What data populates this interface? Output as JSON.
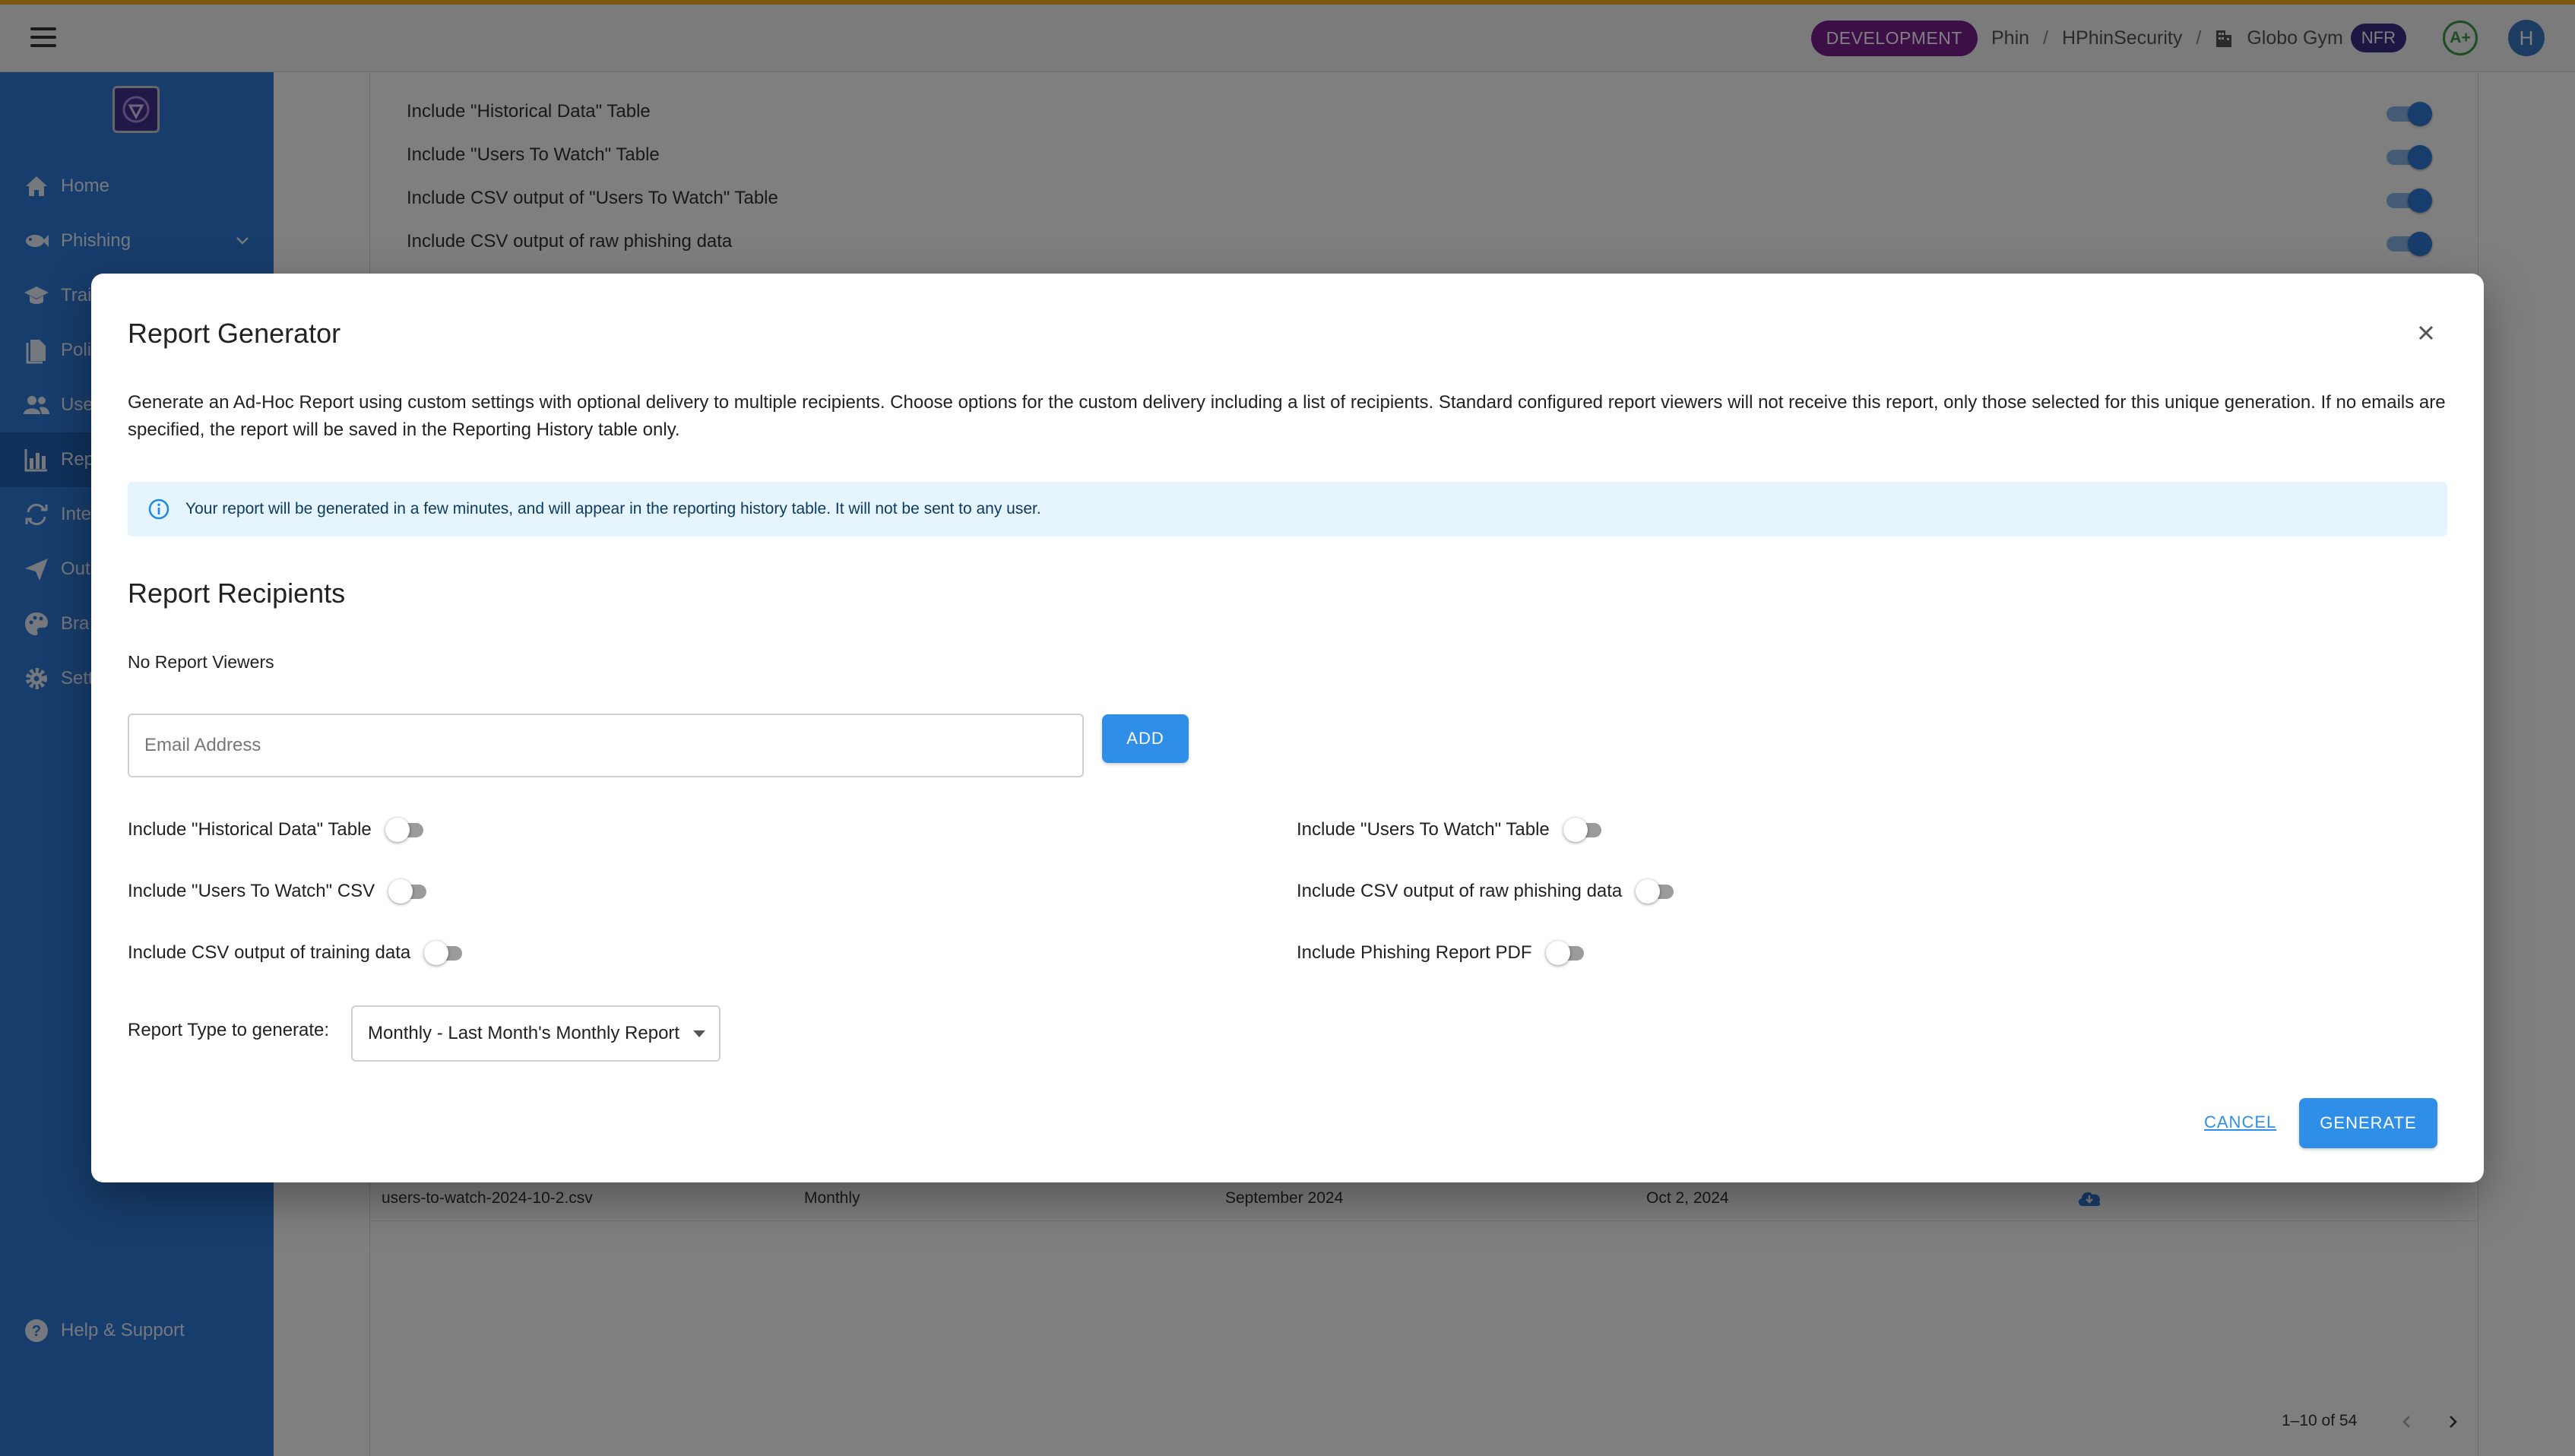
{
  "topbar": {
    "env_badge": "DEVELOPMENT",
    "breadcrumbs": [
      "Phin",
      "HPhinSecurity",
      "Globo Gym"
    ],
    "separator": "/",
    "nfr_badge": "NFR",
    "grade": "A+",
    "avatar_initial": "H",
    "accent_color": "#f5b21b"
  },
  "sidebar": {
    "items": [
      {
        "label": "Home",
        "icon": "home-icon"
      },
      {
        "label": "Phishing",
        "icon": "fish-icon"
      },
      {
        "label": "Trai",
        "icon": "graduation-cap-icon"
      },
      {
        "label": "Poli",
        "icon": "document-icon"
      },
      {
        "label": "Use",
        "icon": "users-icon"
      },
      {
        "label": "Rep",
        "icon": "bar-chart-icon"
      },
      {
        "label": "Inte",
        "icon": "sync-icon"
      },
      {
        "label": "Out",
        "icon": "send-icon"
      },
      {
        "label": "Bra",
        "icon": "palette-icon"
      },
      {
        "label": "Sett",
        "icon": "gear-icon"
      }
    ],
    "help_label": "Help & Support",
    "color": "#2f7ad9"
  },
  "background": {
    "options": [
      "Include \"Historical Data\" Table",
      "Include \"Users To Watch\" Table",
      "Include CSV output of \"Users To Watch\" Table",
      "Include CSV output of raw phishing data"
    ],
    "table_row": {
      "file": "users-to-watch-2024-10-2.csv",
      "frequency": "Monthly",
      "period": "September 2024",
      "date": "Oct 2, 2024"
    },
    "pagination": "1–10 of 54"
  },
  "dialog": {
    "title": "Report Generator",
    "description": "Generate an Ad-Hoc Report using custom settings with optional delivery to multiple recipients. Choose options for the custom delivery including a list of recipients. Standard configured report viewers will not receive this report, only those selected for this unique generation. If no emails are specified, the report will be saved in the Reporting History table only.",
    "alert": "Your report will be generated in a few minutes, and will appear in the reporting history table. It will not be sent to any user.",
    "recipients_title": "Report Recipients",
    "no_viewers": "No Report Viewers",
    "email_placeholder": "Email Address",
    "add_label": "ADD",
    "options_left": [
      {
        "label": "Include \"Historical Data\" Table",
        "checked": false
      },
      {
        "label": "Include \"Users To Watch\" CSV",
        "checked": false
      },
      {
        "label": "Include CSV output of training data",
        "checked": false
      }
    ],
    "options_right": [
      {
        "label": "Include \"Users To Watch\" Table",
        "checked": false
      },
      {
        "label": "Include CSV output of raw phishing data",
        "checked": false
      },
      {
        "label": "Include Phishing Report PDF",
        "checked": false
      }
    ],
    "report_type_label": "Report Type to generate:",
    "report_type_value": "Monthly - Last Month's Monthly Report",
    "cancel_label": "CANCEL",
    "generate_label": "GENERATE",
    "button_color": "#2f8fe8"
  }
}
